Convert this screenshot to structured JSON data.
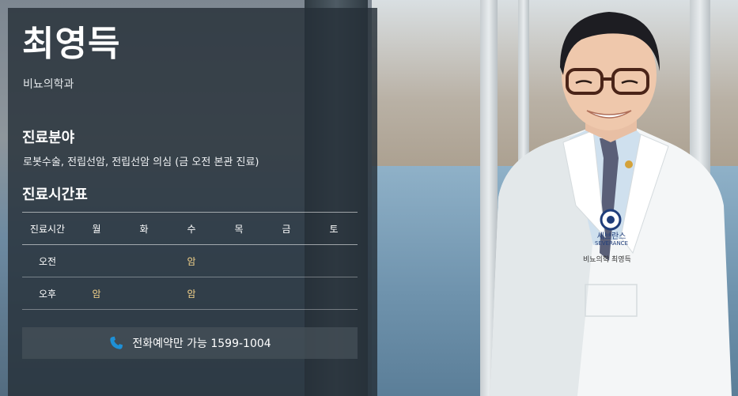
{
  "doctor": {
    "name": "최영득",
    "department": "비뇨의학과"
  },
  "specialty": {
    "title": "진료분야",
    "text": "로봇수술, 전립선암, 전립선암 의심 (금 오전 본관 진료)"
  },
  "schedule": {
    "title": "진료시간표",
    "header": [
      "진료시간",
      "월",
      "화",
      "수",
      "목",
      "금",
      "토"
    ],
    "rows": [
      {
        "label": "오전",
        "cells": [
          "",
          "",
          "암",
          "",
          "",
          ""
        ]
      },
      {
        "label": "오후",
        "cells": [
          "암",
          "",
          "암",
          "",
          "",
          ""
        ]
      }
    ]
  },
  "phone": {
    "label": "전화예약만 가능 1599-1004"
  },
  "badge": {
    "text": "세브란스",
    "text_en": "SEVERANCE",
    "nametag": "비뇨의학 최영득"
  },
  "colors": {
    "panel": "#263038",
    "schedule_mark": "#f3d28a",
    "phone_icon": "#1e90d6"
  }
}
